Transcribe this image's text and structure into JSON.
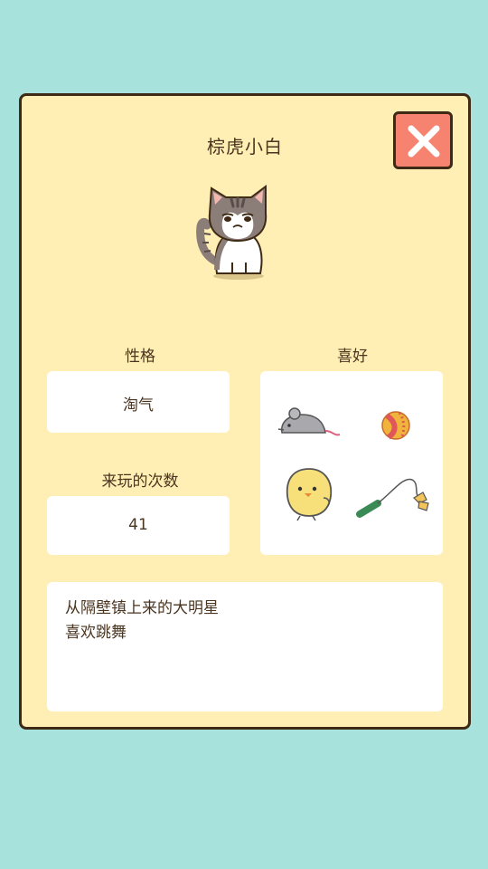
{
  "cat": {
    "name": "棕虎小白"
  },
  "personality": {
    "label": "性格",
    "value": "淘气"
  },
  "hobbies": {
    "label": "喜好",
    "items": [
      "mouse-toy-icon",
      "ball-icon",
      "chick-toy-icon",
      "teaser-wand-icon"
    ]
  },
  "visits": {
    "label": "来玩的次数",
    "value": "41"
  },
  "description": {
    "lines": [
      "从隔壁镇上来的大明星",
      "喜欢跳舞"
    ]
  },
  "colors": {
    "background": "#a8e2dc",
    "panel": "#ffefb4",
    "border": "#3f2a16",
    "close_button": "#f6836f",
    "card": "#ffffff"
  },
  "icons": {
    "close": "close-icon",
    "cat": "cat-icon"
  }
}
